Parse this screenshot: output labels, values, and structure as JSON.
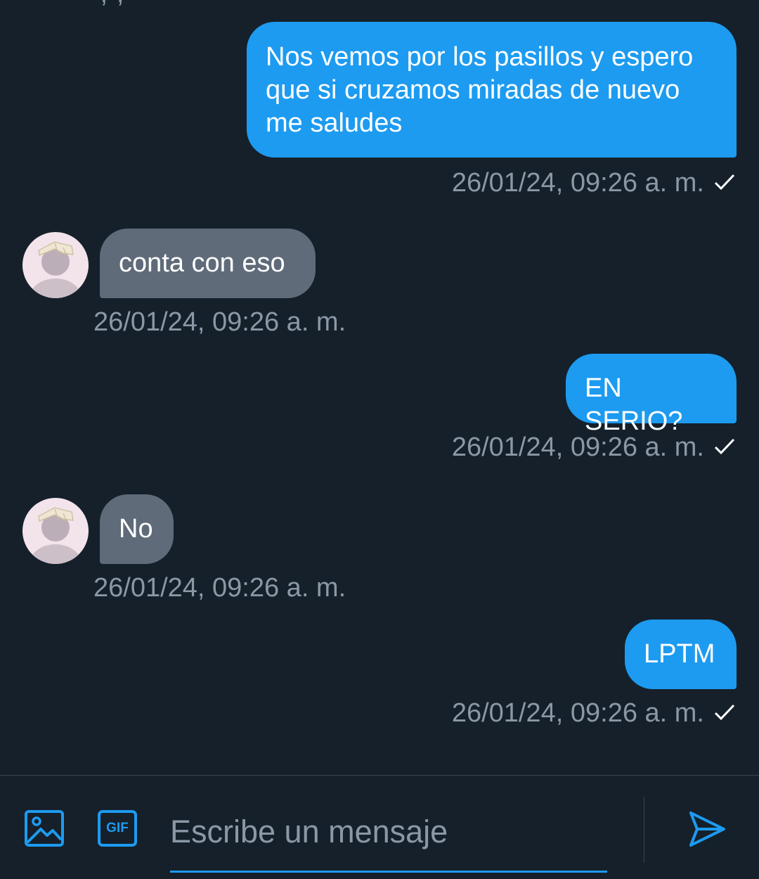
{
  "conversation": {
    "messages": [
      {
        "direction": "out",
        "text": "Nos vemos por los pasillos y espero que si cruzamos miradas de nuevo me saludes",
        "timestamp": "26/01/24, 09:26 a. m."
      },
      {
        "direction": "in",
        "text": "conta con eso",
        "timestamp": "26/01/24, 09:26 a. m."
      },
      {
        "direction": "out",
        "text": "EN SERIO?",
        "timestamp": "26/01/24, 09:26 a. m."
      },
      {
        "direction": "in",
        "text": "No",
        "timestamp": "26/01/24, 09:26 a. m."
      },
      {
        "direction": "out",
        "text": "LPTM",
        "timestamp": "26/01/24, 09:26 a. m."
      }
    ]
  },
  "composer": {
    "placeholder": "Escribe un mensaje",
    "gif_label": "GIF",
    "icons": [
      "image-icon",
      "gif-icon",
      "send-icon"
    ]
  },
  "colors": {
    "background": "#15202b",
    "outgoing_bubble": "#1d9bf0",
    "incoming_bubble": "#5f6b79",
    "timestamp": "#8b98a5",
    "accent": "#1d9bf0"
  }
}
